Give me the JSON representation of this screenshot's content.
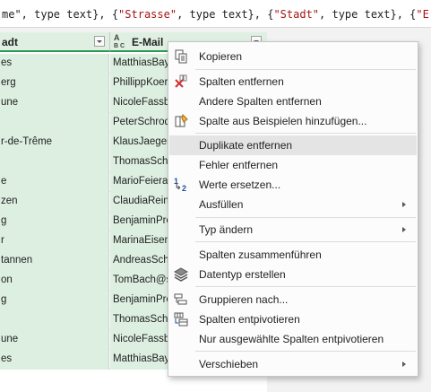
{
  "formula_bar": {
    "parts": [
      {
        "t": "me\", type text}, {",
        "s": false
      },
      {
        "t": "\"Strasse\"",
        "s": true
      },
      {
        "t": ", type text}, {",
        "s": false
      },
      {
        "t": "\"Stadt\"",
        "s": true
      },
      {
        "t": ", type text}, {",
        "s": false
      },
      {
        "t": "\"E-Mail\"",
        "s": true
      },
      {
        "t": ",",
        "s": false
      }
    ]
  },
  "columns": [
    {
      "header": "adt",
      "type_icon": "text-type-icon"
    },
    {
      "header": "E-Mail",
      "type_icon_top": "A",
      "type_icon_bottom": "B C",
      "type_icon": "text-type-icon"
    }
  ],
  "rows": [
    {
      "city": "es",
      "email": "MatthiasBay"
    },
    {
      "city": "erg",
      "email": "PhillippKoer"
    },
    {
      "city": "une",
      "email": "NicoleFassbi"
    },
    {
      "city": "",
      "email": "PeterSchrod"
    },
    {
      "city": "r-de-Trême",
      "email": "KlausJaeger("
    },
    {
      "city": "",
      "email": "ThomasSchr"
    },
    {
      "city": "e",
      "email": "MarioFeiera"
    },
    {
      "city": "zen",
      "email": "ClaudiaReini"
    },
    {
      "city": "g",
      "email": "BenjaminPro"
    },
    {
      "city": "r",
      "email": "MarinaEisen"
    },
    {
      "city": "tannen",
      "email": "AndreasSchu"
    },
    {
      "city": "on",
      "email": "TomBach@s"
    },
    {
      "city": "g",
      "email": "BenjaminPro"
    },
    {
      "city": "",
      "email": "ThomasSchr"
    },
    {
      "city": "une",
      "email": "NicoleFassbi"
    },
    {
      "city": "es",
      "email": "MatthiasBay"
    }
  ],
  "menu": {
    "items": [
      {
        "label": "Kopieren",
        "icon": "copy-icon"
      },
      {
        "label": "Spalten entfernen",
        "icon": "remove-columns-icon"
      },
      {
        "label": "Andere Spalten entfernen",
        "icon": ""
      },
      {
        "label": "Spalte aus Beispielen hinzufügen...",
        "icon": "column-from-examples-icon"
      },
      {
        "label": "Duplikate entfernen",
        "icon": ""
      },
      {
        "label": "Fehler entfernen",
        "icon": ""
      },
      {
        "label": "Werte ersetzen...",
        "icon": "replace-values-icon"
      },
      {
        "label": "Ausfüllen",
        "icon": ""
      },
      {
        "label": "Typ ändern",
        "icon": ""
      },
      {
        "label": "Spalten zusammenführen",
        "icon": ""
      },
      {
        "label": "Datentyp erstellen",
        "icon": "create-data-type-icon"
      },
      {
        "label": "Gruppieren nach...",
        "icon": "group-by-icon"
      },
      {
        "label": "Spalten entpivotieren",
        "icon": "unpivot-columns-icon"
      },
      {
        "label": "Nur ausgewählte Spalten entpivotieren",
        "icon": ""
      },
      {
        "label": "Verschieben",
        "icon": ""
      }
    ],
    "highlighted": "Duplikate entfernen",
    "replace_icon_digits": {
      "top": "1",
      "bottom": "2"
    }
  },
  "colors": {
    "header_bg": "#dff0e2",
    "header_underline": "#2e9b57",
    "selected_cell_bg": "#dcefe1",
    "menu_highlight": "#e4e4e4",
    "formula_string": "#a31515"
  }
}
